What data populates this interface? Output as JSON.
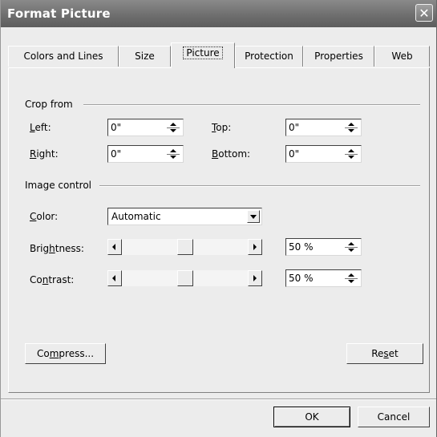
{
  "window": {
    "title": "Format Picture",
    "close_glyph": "✕"
  },
  "tabs": [
    {
      "label": "Colors and Lines"
    },
    {
      "label": "Size"
    },
    {
      "label": "Picture"
    },
    {
      "label": "Protection"
    },
    {
      "label": "Properties"
    },
    {
      "label": "Web"
    }
  ],
  "active_tab": "Picture",
  "crop": {
    "group_label": "Crop from",
    "left": {
      "label_key": "L",
      "label_rest": "eft:",
      "value": "0\""
    },
    "right": {
      "label_key": "R",
      "label_rest": "ight:",
      "value": "0\""
    },
    "top": {
      "label_key": "T",
      "label_rest": "op:",
      "value": "0\""
    },
    "bottom": {
      "label_key": "B",
      "label_rest": "ottom:",
      "value": "0\""
    }
  },
  "image_control": {
    "group_label": "Image control",
    "color": {
      "label_key": "C",
      "label_rest": "olor:",
      "value": "Automatic"
    },
    "brightness": {
      "label_pre": "Brig",
      "label_key": "h",
      "label_rest": "tness:",
      "value": "50 %",
      "level": 0.5
    },
    "contrast": {
      "label_pre": "Co",
      "label_key": "n",
      "label_rest": "trast:",
      "value": "50 %",
      "level": 0.5
    }
  },
  "buttons": {
    "compress": {
      "pre": "Co",
      "key": "m",
      "rest": "press..."
    },
    "reset": {
      "pre": "Re",
      "key": "s",
      "rest": "et"
    },
    "ok": "OK",
    "cancel": "Cancel"
  }
}
